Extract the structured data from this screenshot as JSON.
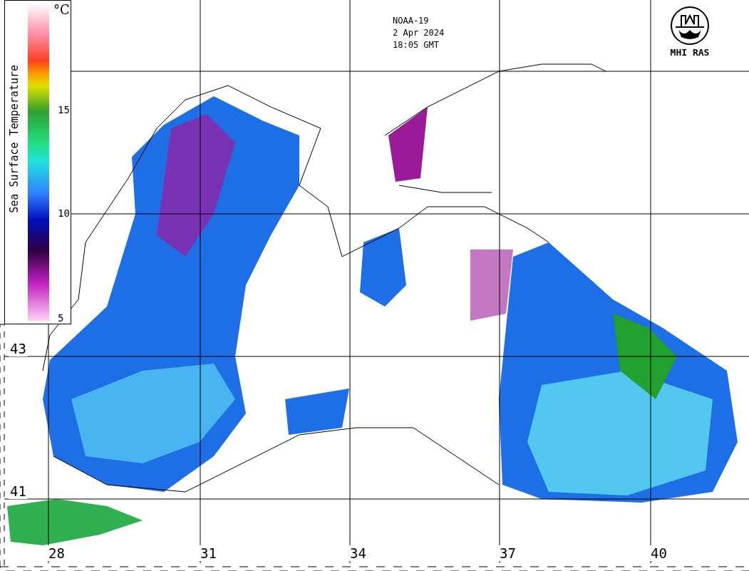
{
  "header": {
    "satellite": "NOAA-19",
    "date": "2 Apr 2024",
    "time": "18:05 GMT"
  },
  "logo": {
    "label": "MHI RAS"
  },
  "legend": {
    "title": "Sea Surface Temperature",
    "unit": "°C",
    "ticks": [
      "15",
      "10",
      "5"
    ]
  },
  "latitude_labels": [
    "43",
    "41"
  ],
  "longitude_labels": [
    "28",
    "31",
    "34",
    "37",
    "40"
  ]
}
